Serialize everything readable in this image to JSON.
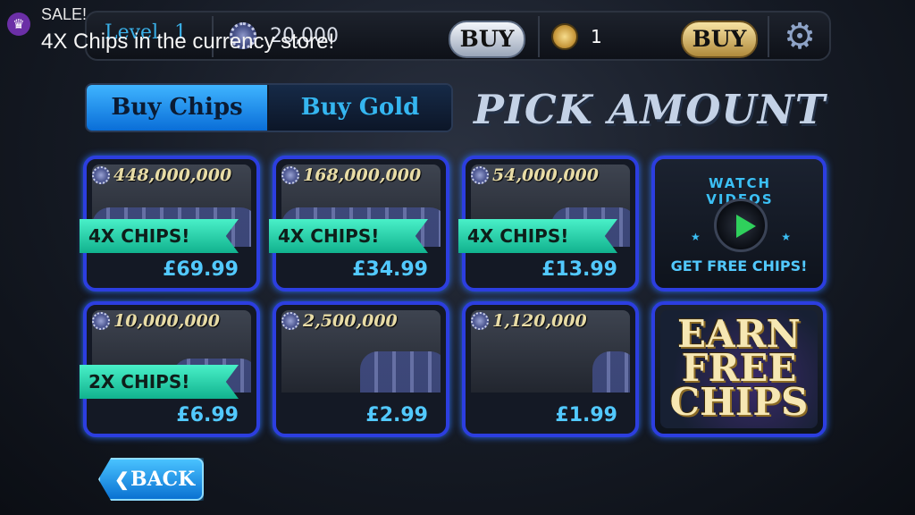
{
  "notification": {
    "title": "SALE!",
    "text": "4X Chips in the currency store!",
    "icon": "crown-icon",
    "icon_glyph": "♛"
  },
  "topbar": {
    "level_label": "Level",
    "level_value": "1",
    "chips_amount": "20,000",
    "buy_chips_label": "BUY",
    "gold_amount": "1",
    "buy_gold_label": "BUY",
    "settings_icon": "gear-icon",
    "settings_glyph": "⚙"
  },
  "tabs": [
    {
      "label": "Buy Chips",
      "active": true
    },
    {
      "label": "Buy Gold",
      "active": false
    }
  ],
  "heading": "PICK AMOUNT",
  "packages": [
    {
      "amount": "448,000,000",
      "badge": "4X CHIPS!",
      "price": "£69.99"
    },
    {
      "amount": "168,000,000",
      "badge": "4X CHIPS!",
      "price": "£34.99"
    },
    {
      "amount": "54,000,000",
      "badge": "4X CHIPS!",
      "price": "£13.99"
    },
    {
      "amount": "10,000,000",
      "badge": "2X CHIPS!",
      "price": "£6.99"
    },
    {
      "amount": "2,500,000",
      "badge": "",
      "price": "£2.99"
    },
    {
      "amount": "1,120,000",
      "badge": "",
      "price": "£1.99"
    }
  ],
  "watch_videos": {
    "title": "WATCH VIDEOS",
    "cta": "GET FREE CHIPS!",
    "stars": [
      "★",
      "★"
    ]
  },
  "earn_free": {
    "line1": "EARN",
    "line2": "FREE",
    "line3": "CHIPS"
  },
  "back": {
    "label": "BACK",
    "glyph": "❮"
  },
  "colors": {
    "accent_blue": "#2c3ee0",
    "price_blue": "#52c9ff",
    "ribbon_teal": "#2fe0b8"
  }
}
